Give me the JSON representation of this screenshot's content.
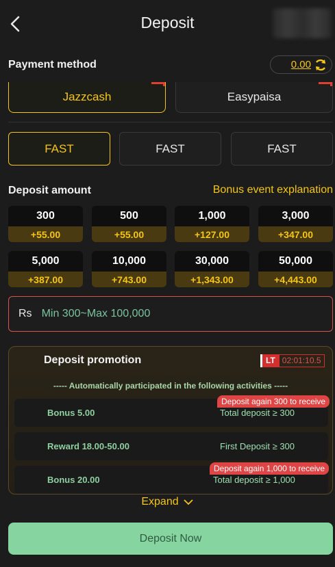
{
  "header": {
    "title": "Deposit"
  },
  "payment": {
    "label": "Payment method",
    "balance": "0.00",
    "methods": [
      "Jazzcash",
      "Easypaisa"
    ]
  },
  "channels": [
    "FAST",
    "FAST",
    "FAST"
  ],
  "deposit_amount": {
    "label": "Deposit amount",
    "bonus_link": "Bonus event explanation",
    "options": [
      {
        "amount": "300",
        "bonus": "+55.00"
      },
      {
        "amount": "500",
        "bonus": "+55.00"
      },
      {
        "amount": "1,000",
        "bonus": "+127.00"
      },
      {
        "amount": "3,000",
        "bonus": "+347.00"
      },
      {
        "amount": "5,000",
        "bonus": "+387.00"
      },
      {
        "amount": "10,000",
        "bonus": "+743.00"
      },
      {
        "amount": "30,000",
        "bonus": "+1,343.00"
      },
      {
        "amount": "50,000",
        "bonus": "+4,443.00"
      }
    ]
  },
  "input": {
    "currency": "Rs",
    "placeholder": "Min 300~Max 100,000"
  },
  "promotion": {
    "title": "Deposit promotion",
    "lt": "LT",
    "timer": "02:01:10.5",
    "subtitle": "----- Automatically participated in the following activities -----",
    "rows": [
      {
        "left": "Bonus 5.00",
        "right": "Total deposit ≥ 300",
        "tag": "Deposit again 300 to receive"
      },
      {
        "left": "Reward 18.00-50.00",
        "right": "First Deposit ≥ 300",
        "tag": ""
      },
      {
        "left": "Bonus 20.00",
        "right": "Total deposit ≥ 1,000",
        "tag": "Deposit again 1,000 to receive"
      }
    ]
  },
  "expand_label": "Expand",
  "deposit_button": "Deposit Now",
  "colors": {
    "accent": "#f5c518",
    "primary_button": "#86d5a1",
    "alert": "#e04545"
  }
}
